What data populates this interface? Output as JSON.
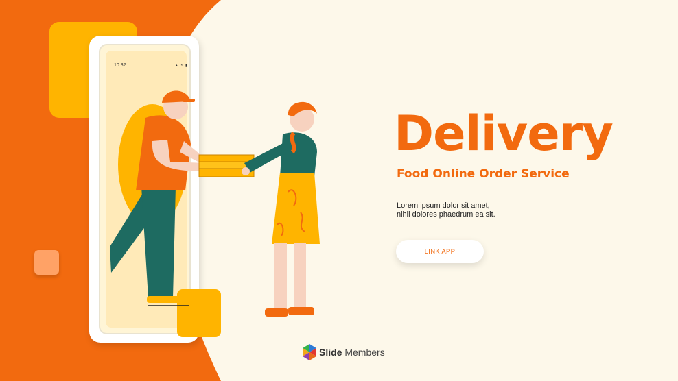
{
  "slide": {
    "title": "Delivery",
    "subtitle": "Food Online Order Service",
    "body_lines": [
      "Lorem ipsum dolor sit amet,",
      "nihil dolores phaedrum ea sit."
    ],
    "button_label": "LINK APP"
  },
  "phone": {
    "time": "10:32"
  },
  "brand": {
    "logo_word1": "Slide",
    "logo_word2": " Members"
  },
  "colors": {
    "accent_orange": "#f26a0f",
    "yellow": "#ffb400",
    "background": "#fdf8ea",
    "light_orange": "#ffa266"
  },
  "illustration": {
    "icons": [
      "delivery-man-figure",
      "customer-woman-figure",
      "pizza-boxes",
      "smartphone"
    ]
  }
}
